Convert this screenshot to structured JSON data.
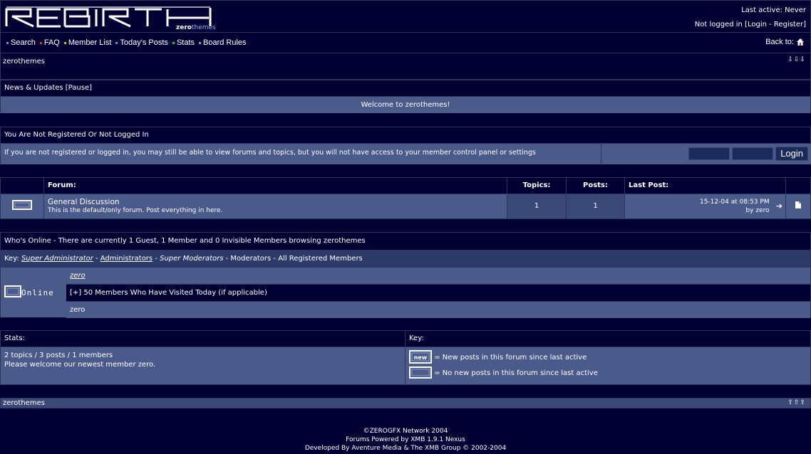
{
  "header": {
    "logo_text": "REBIRTH",
    "logo_sub_a": "zero",
    "logo_sub_b": "themes",
    "last_active": "Last active: Never",
    "not_logged_in": "Not logged in [",
    "login_link": "Login",
    "sep": " - ",
    "register_link": "Register",
    "close_bracket": "]"
  },
  "nav": {
    "items": [
      {
        "label": "Search",
        "bullet": "#7c8cc0"
      },
      {
        "label": "FAQ",
        "bullet": "#c04040"
      },
      {
        "label": "Member List",
        "bullet": "#c0c040"
      },
      {
        "label": "Today's Posts",
        "bullet": "#40a0c0"
      },
      {
        "label": "Stats",
        "bullet": "#40c040"
      },
      {
        "label": "Board Rules",
        "bullet": "#c080c0"
      }
    ],
    "back_to": "Back to:"
  },
  "breadcrumb": {
    "text": "zerothemes",
    "arrows": "⇩⇩⇩"
  },
  "news": {
    "title": "News & Updates [Pause]",
    "message": "Welcome to zerothemes!"
  },
  "notice": {
    "title": "You Are Not Registered Or Not Logged In",
    "text": "If you are not registered or logged in, you may still be able to view forums and topics, but you will not have access to your member control panel or settings",
    "login_button": "Login"
  },
  "forum_table": {
    "headers": {
      "forum": "Forum:",
      "topics": "Topics:",
      "posts": "Posts:",
      "last_post": "Last Post:"
    },
    "rows": [
      {
        "name": "General Discussion",
        "description": "This is the default/only forum. Post everything in here.",
        "topics": "1",
        "posts": "1",
        "last_post_date": "15-12-04 at 08:53 PM",
        "last_post_by": "by zero"
      }
    ]
  },
  "online": {
    "title": "Who's Online - There are currently 1 Guest, 1 Member and 0 Invisible Members browsing zerothemes",
    "key_label": "Key: ",
    "key_super_admin": "Super Administrator",
    "key_admins": "Administrators",
    "key_super_mods": "Super Moderators",
    "key_rest": " - Moderators - All Registered Members",
    "dash": " - ",
    "online_logo": "Online",
    "user": "zero",
    "visited_today": "[+] 50 Members Who Have Visited Today (if applicable)",
    "visited_user": "zero"
  },
  "stats": {
    "title": "Stats:",
    "line1": "2 topics / 3 posts / 1 members",
    "line2": "Please welcome our newest member zero.",
    "key_title": "Key:",
    "key_new": "= New posts in this forum since last active",
    "key_old": "= No new posts in this forum since last active",
    "new_icon_text": "new"
  },
  "bottom_crumb": {
    "text": "zerothemes",
    "arrows": "⇧⇧⇧"
  },
  "credits": {
    "line1": "©ZEROGFX Network 2004",
    "line2": "Forums Powered by XMB 1.9.1 Nexus",
    "line3": "Developed By Aventure Media & The XMB Group © 2002-2004"
  }
}
